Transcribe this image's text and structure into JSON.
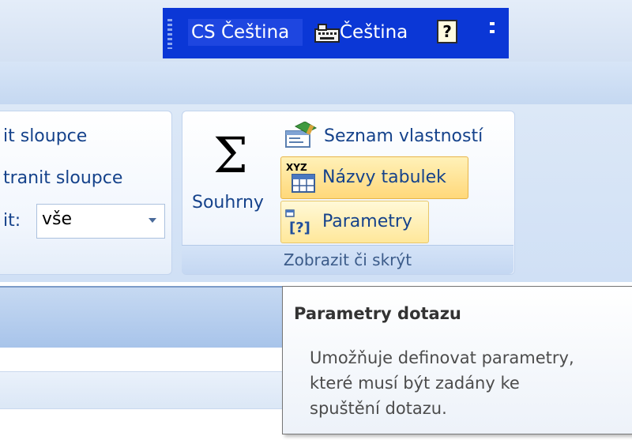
{
  "language_bar": {
    "input_language": "CS Čeština",
    "keyboard_layout": "Čeština",
    "help_glyph": "?",
    "accent": "#0b37d6"
  },
  "ribbon": {
    "show_columns_label": "it sloupce",
    "hide_columns_label": "tranit sloupce",
    "filter_label": "it:",
    "filter_value": "vše",
    "totals_label": "Souhrny",
    "totals_symbol": "Σ",
    "property_sheet_label": "Seznam vlastností",
    "table_names_label": "Názvy tabulek",
    "table_names_icon_text": "XYZ",
    "parameters_label": "Parametry",
    "group_label": "Zobrazit či skrýt"
  },
  "tooltip": {
    "title": "Parametry dotazu",
    "lines": [
      "Umožňuje definovat parametry,",
      "které musí být zadány ke",
      "spuštění dotazu."
    ]
  }
}
